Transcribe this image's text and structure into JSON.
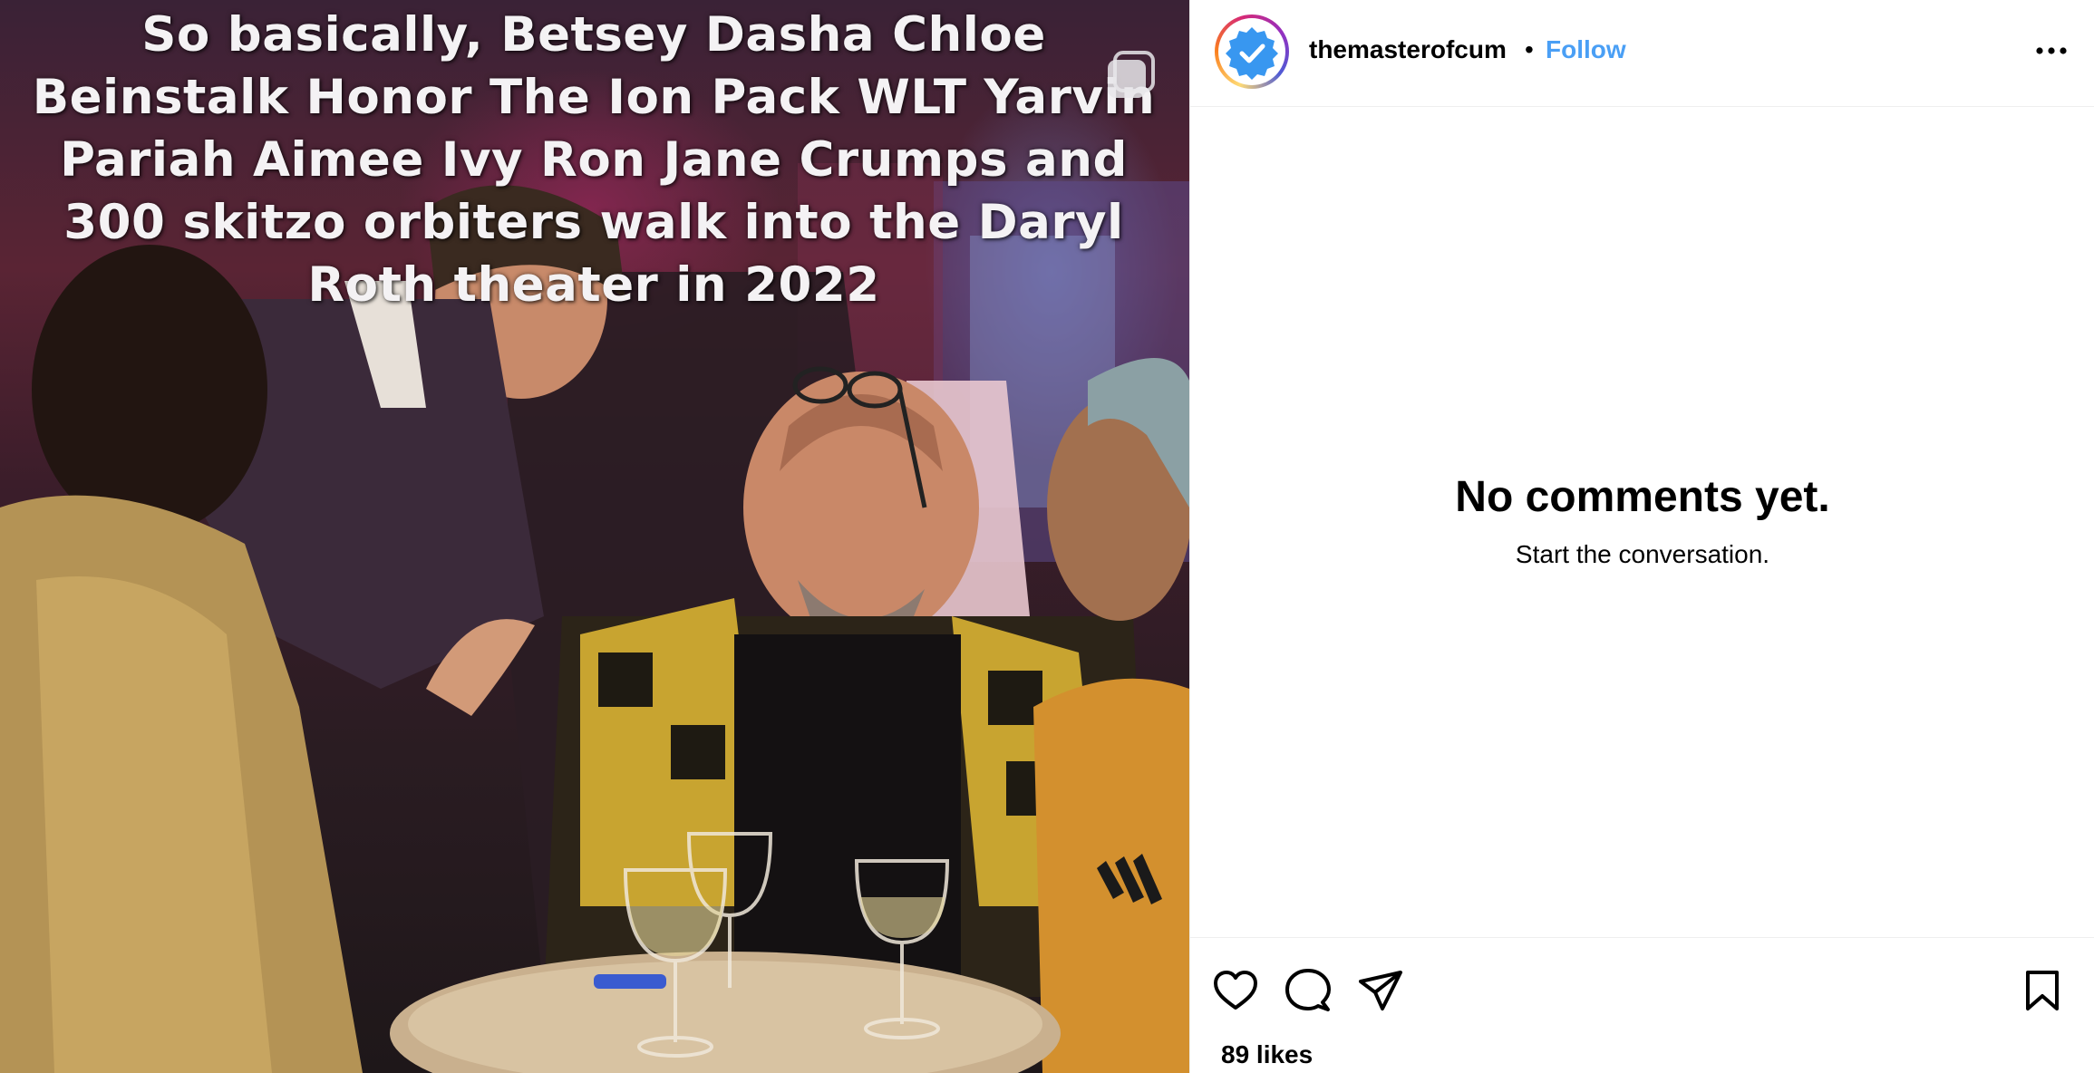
{
  "post": {
    "caption": "So basically, Betsey Dasha Chloe Beinstalk Honor The Ion Pack WLT Yarvin Pariah Aimee Ivy Ron Jane Crumps and 300 skitzo orbiters walk into the Daryl Roth theater in 2022",
    "media_icon": "carousel-icon"
  },
  "header": {
    "username": "themasterofcum",
    "separator": "•",
    "follow_label": "Follow",
    "avatar_icon": "verified-badge-icon",
    "more_icon": "more-horizontal-icon"
  },
  "comments": {
    "empty_title": "No comments yet.",
    "empty_subtitle": "Start the conversation."
  },
  "actions": {
    "like_icon": "heart-icon",
    "comment_icon": "comment-icon",
    "share_icon": "send-icon",
    "save_icon": "bookmark-icon",
    "likes_text": "89 likes"
  },
  "colors": {
    "follow": "#4a9ff5",
    "verified": "#3897f0",
    "divider": "#efefef"
  }
}
